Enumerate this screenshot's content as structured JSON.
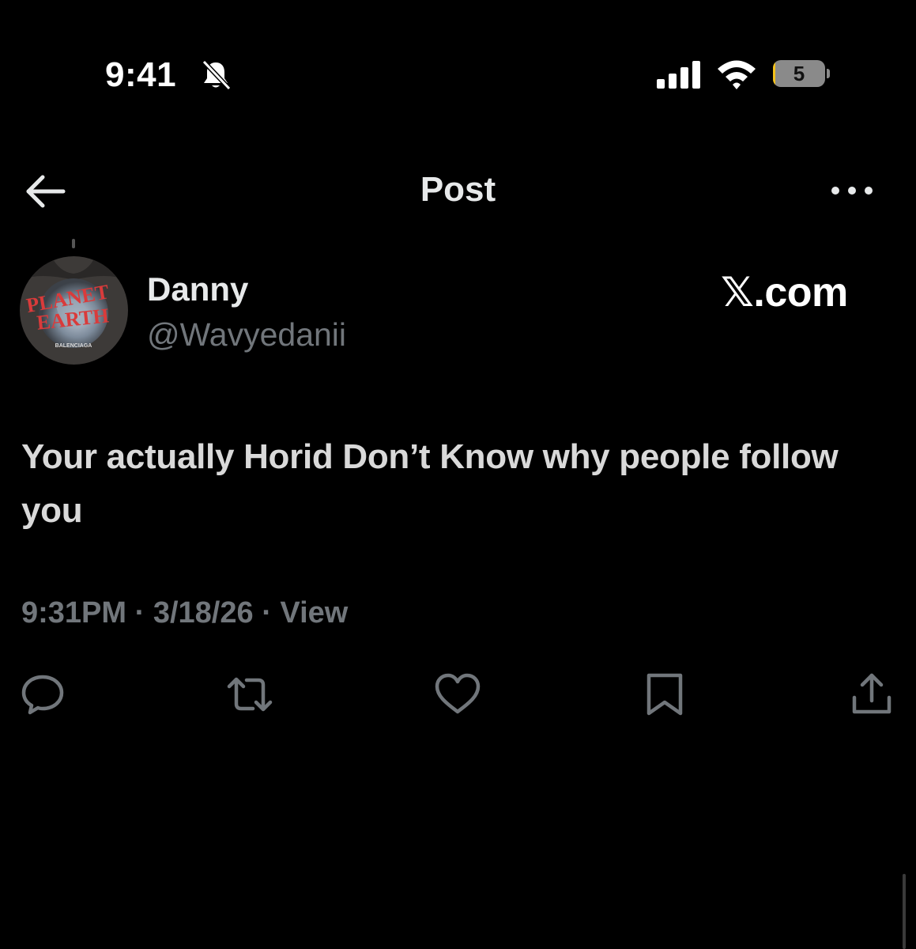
{
  "status_bar": {
    "time": "9:41",
    "battery_level": "5",
    "battery_fraction": 0.05,
    "icons": [
      "bell-slash-icon",
      "cellular-signal-icon",
      "wifi-icon",
      "battery-icon"
    ]
  },
  "header": {
    "title": "Post",
    "back_icon": "arrow-left-icon",
    "more_icon": "more-horizontal-icon"
  },
  "author": {
    "name": "Danny",
    "handle": "@Wavyedanii",
    "avatar_text": [
      "PLANET",
      "EARTH",
      "BALENCIAGA"
    ]
  },
  "watermark": "𝕏.com",
  "post": {
    "text": "Your actually Horid Don’t Know why people follow you",
    "time": "9:31PM",
    "date": "3/18/26",
    "views_label": "View",
    "separator": " · "
  },
  "actions": [
    {
      "name": "reply",
      "icon": "reply-icon"
    },
    {
      "name": "repost",
      "icon": "repost-icon"
    },
    {
      "name": "like",
      "icon": "heart-icon"
    },
    {
      "name": "bookmark",
      "icon": "bookmark-icon"
    },
    {
      "name": "share",
      "icon": "share-icon"
    }
  ],
  "colors": {
    "background": "#000000",
    "primary_text": "#e7e9ea",
    "secondary_text": "#71767b",
    "battery_fill": "#f4c21b"
  }
}
